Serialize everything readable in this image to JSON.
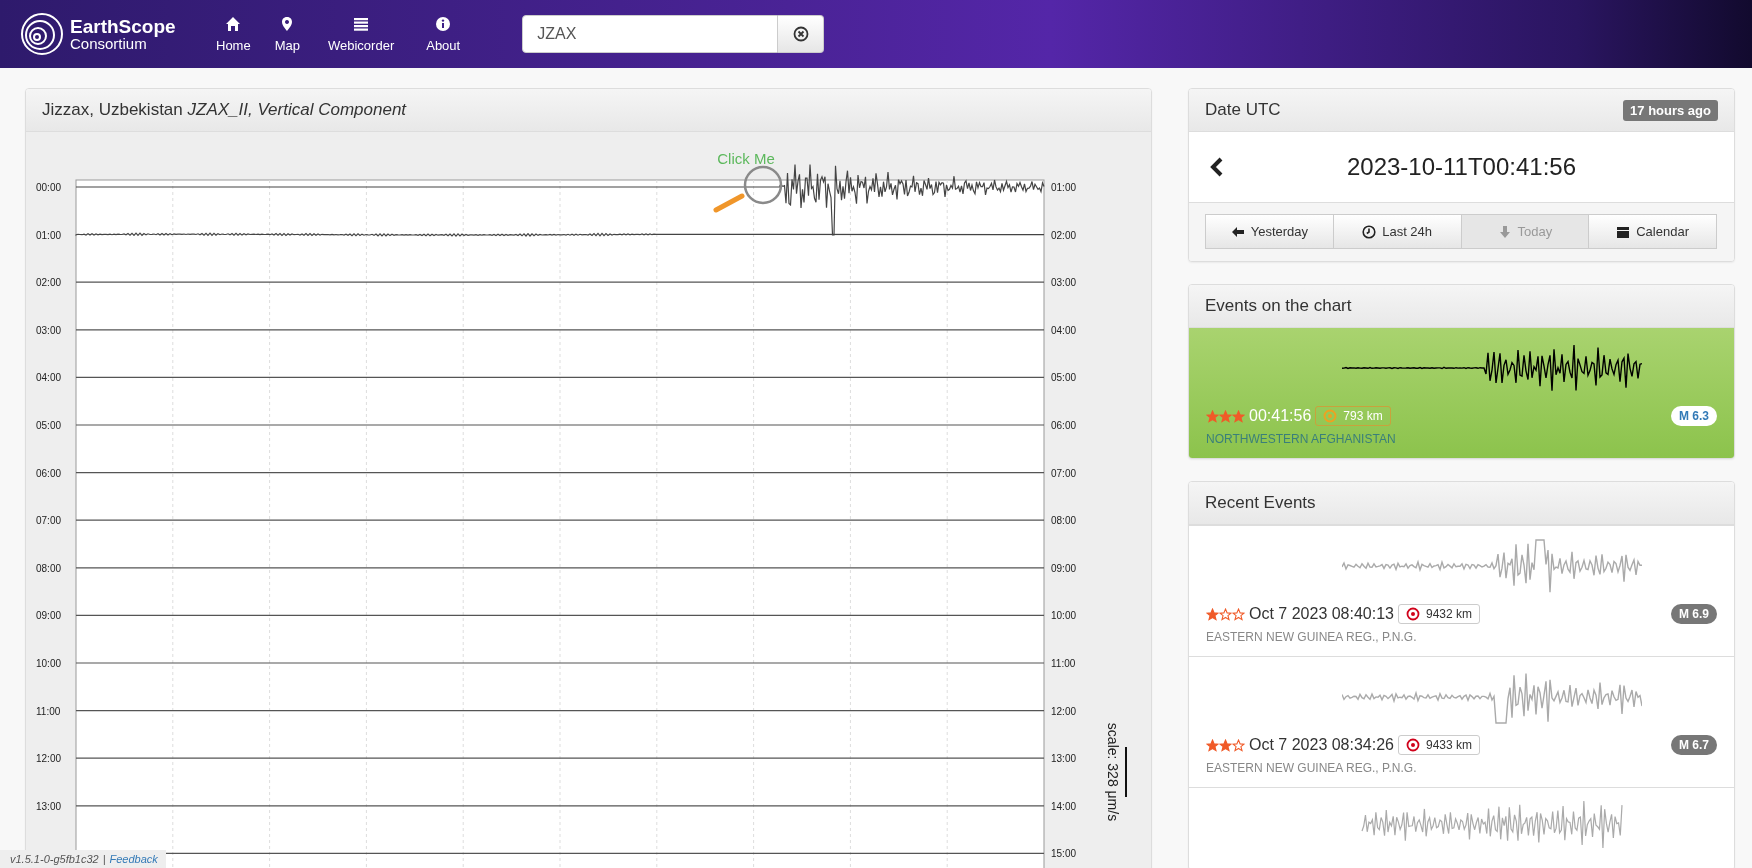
{
  "header": {
    "logo": {
      "line1": "EarthScope",
      "line2": "Consortium"
    },
    "nav": [
      {
        "label": "Home"
      },
      {
        "label": "Map"
      },
      {
        "label": "Webicorder"
      },
      {
        "label": "About"
      }
    ],
    "search": {
      "value": "JZAX"
    }
  },
  "station": {
    "title": "Jizzax, Uzbekistan *JZAX_II, Vertical Component*"
  },
  "helicorder": {
    "hint": "Click Me",
    "left_labels": [
      "00:00",
      "01:00",
      "02:00",
      "03:00",
      "04:00",
      "05:00",
      "06:00",
      "07:00",
      "08:00",
      "09:00",
      "10:00",
      "11:00",
      "12:00",
      "13:00"
    ],
    "right_labels": [
      "01:00",
      "02:00",
      "03:00",
      "04:00",
      "05:00",
      "06:00",
      "07:00",
      "08:00",
      "09:00",
      "10:00",
      "11:00",
      "12:00",
      "13:00",
      "14:00",
      "15:00"
    ],
    "scale": "scale: 328 μm/s"
  },
  "date_panel": {
    "title": "Date UTC",
    "badge": "17 hours ago",
    "date": "2023-10-11T00:41:56",
    "buttons": [
      {
        "label": "Yesterday",
        "disabled": false
      },
      {
        "label": "Last 24h",
        "disabled": false
      },
      {
        "label": "Today",
        "disabled": true
      },
      {
        "label": "Calendar",
        "disabled": false
      }
    ]
  },
  "chart_events": {
    "title": "Events on the chart",
    "items": [
      {
        "kind": "full",
        "stars": 3,
        "time": "00:41:56",
        "distance": "793 km",
        "location": "NORTHWESTERN AFGHANISTAN",
        "magnitude": "M 6.3",
        "selected": true
      }
    ]
  },
  "recent_events": {
    "title": "Recent Events",
    "items": [
      {
        "kind": "full",
        "stars": 1,
        "time": "Oct 7 2023 08:40:13",
        "distance": "9432 km",
        "location": "EASTERN NEW GUINEA REG., P.N.G.",
        "magnitude": "M 6.9",
        "selected": false
      },
      {
        "kind": "full",
        "stars": 2,
        "time": "Oct 7 2023 08:34:26",
        "distance": "9433 km",
        "location": "EASTERN NEW GUINEA REG., P.N.G.",
        "magnitude": "M 6.7",
        "selected": false
      },
      {
        "kind": "partial"
      }
    ]
  },
  "footer": {
    "version": "v1.5.1-0-g5fb1c32",
    "separator": "|",
    "link": "Feedback"
  }
}
